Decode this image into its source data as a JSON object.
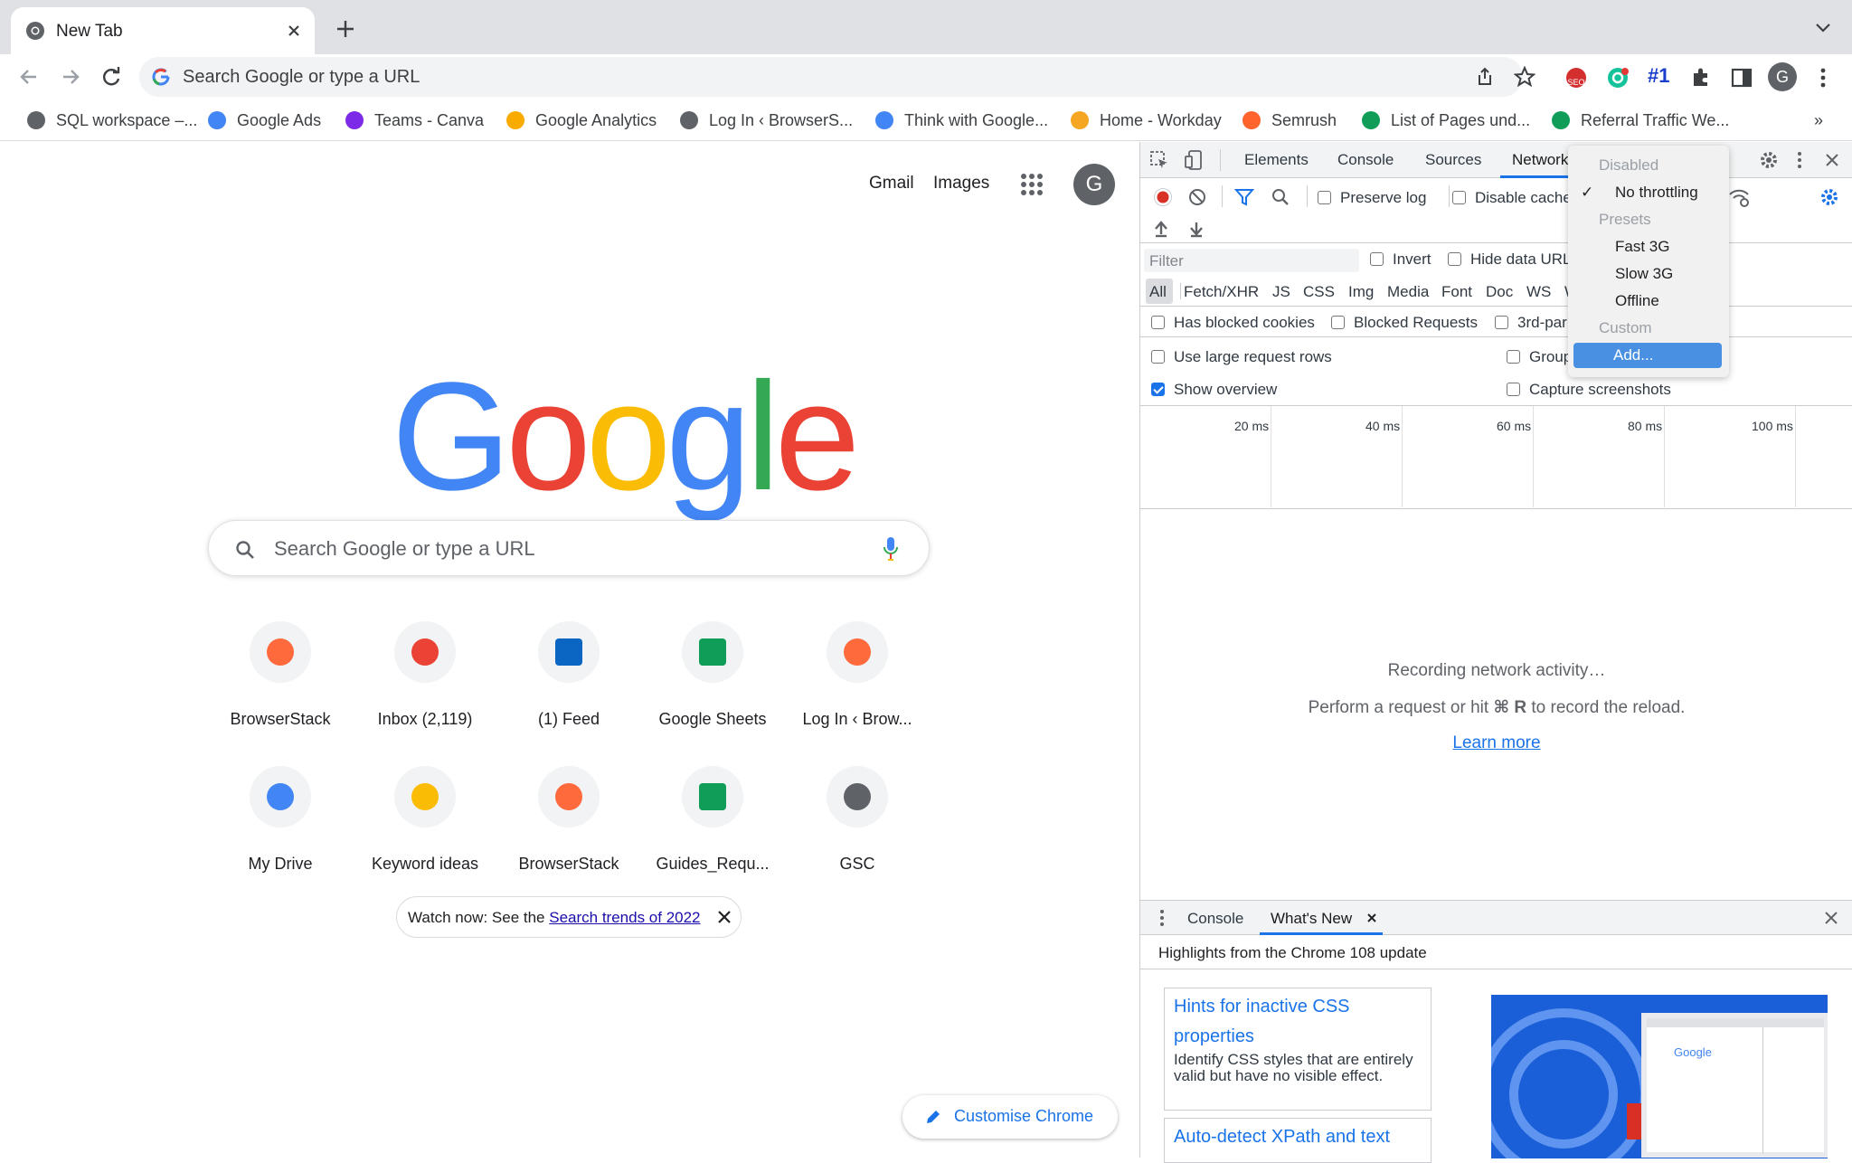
{
  "tab": {
    "title": "New Tab",
    "favicon": "chrome-icon"
  },
  "omnibox": {
    "placeholder": "Search Google or type a URL"
  },
  "toolbar": {
    "extension_badge": "#1",
    "profile_initial": "G"
  },
  "bookmarks": [
    {
      "label": "SQL workspace –...",
      "icon": "gear-icon",
      "color": "#5f6368"
    },
    {
      "label": "Google Ads",
      "icon": "google-ads-icon",
      "color": "#4285f4"
    },
    {
      "label": "Teams - Canva",
      "icon": "canva-icon",
      "color": "#7d2ae8"
    },
    {
      "label": "Google Analytics",
      "icon": "analytics-icon",
      "color": "#f9ab00"
    },
    {
      "label": "Log In ‹ BrowserS...",
      "icon": "globe-icon",
      "color": "#5f6368"
    },
    {
      "label": "Think with Google...",
      "icon": "google-g-icon",
      "color": "#4285f4"
    },
    {
      "label": "Home - Workday",
      "icon": "workday-icon",
      "color": "#f5a623"
    },
    {
      "label": "Semrush",
      "icon": "semrush-icon",
      "color": "#ff642d"
    },
    {
      "label": "List of Pages und...",
      "icon": "sheets-icon",
      "color": "#0f9d58"
    },
    {
      "label": "Referral Traffic We...",
      "icon": "sheets-icon",
      "color": "#0f9d58"
    }
  ],
  "ntp": {
    "links": {
      "gmail": "Gmail",
      "images": "Images"
    },
    "avatar": "G",
    "logo": "Google",
    "search_placeholder": "Search Google or type a URL",
    "tiles": [
      {
        "label": "BrowserStack",
        "icon": "browserstack-icon"
      },
      {
        "label": "Inbox (2,119)",
        "icon": "gmail-icon"
      },
      {
        "label": "(1) Feed",
        "icon": "linkedin-icon"
      },
      {
        "label": "Google Sheets",
        "icon": "sheets-icon"
      },
      {
        "label": "Log In ‹ Brow...",
        "icon": "browserstack-icon"
      },
      {
        "label": "My Drive",
        "icon": "drive-icon"
      },
      {
        "label": "Keyword ideas",
        "icon": "google-ads-icon"
      },
      {
        "label": "BrowserStack",
        "icon": "browserstack-icon"
      },
      {
        "label": "Guides_Requ...",
        "icon": "sheets-icon"
      },
      {
        "label": "GSC",
        "icon": "gsc-icon"
      }
    ],
    "promo": {
      "prefix": "Watch now: See the ",
      "link": "Search trends of 2022"
    },
    "customise": "Customise Chrome"
  },
  "devtools": {
    "tabs": [
      "Elements",
      "Console",
      "Sources",
      "Network"
    ],
    "active_tab": "Network",
    "toolbar": {
      "preserve_log": "Preserve log",
      "disable_cache": "Disable cache"
    },
    "filter": {
      "placeholder": "Filter",
      "invert": "Invert",
      "hide_data_urls": "Hide data URL"
    },
    "type_filters": [
      "All",
      "Fetch/XHR",
      "JS",
      "CSS",
      "Img",
      "Media",
      "Font",
      "Doc",
      "WS",
      "W"
    ],
    "checks": {
      "has_blocked_cookies": "Has blocked cookies",
      "blocked_requests": "Blocked Requests",
      "third_party": "3rd-par",
      "use_large_rows": "Use large request rows",
      "group": "Group",
      "show_overview": "Show overview",
      "capture_screenshots": "Capture screenshots"
    },
    "show_overview_checked": true,
    "timeline_ticks": [
      "20 ms",
      "40 ms",
      "60 ms",
      "80 ms",
      "100 ms"
    ],
    "empty": {
      "line1": "Recording network activity…",
      "line2_pre": "Perform a request or hit ",
      "line2_keys": "⌘ R",
      "line2_post": " to record the reload.",
      "learn_more": "Learn more"
    },
    "throttling_menu": {
      "disabled_header": "Disabled",
      "no_throttling": "No throttling",
      "presets_header": "Presets",
      "fast3g": "Fast 3G",
      "slow3g": "Slow 3G",
      "offline": "Offline",
      "custom_header": "Custom",
      "add": "Add..."
    },
    "drawer": {
      "tabs": [
        "Console",
        "What's New"
      ],
      "active": "What's New",
      "highlights": "Highlights from the Chrome 108 update",
      "card1_title": "Hints for inactive CSS properties",
      "card1_desc": "Identify CSS styles that are entirely valid but have no visible effect.",
      "card2_title": "Auto-detect XPath and text",
      "thumb_logo": "Google"
    }
  },
  "colors": {
    "accent": "#1a73e8",
    "record": "#d93025",
    "menu_selected": "#4a90e2"
  }
}
